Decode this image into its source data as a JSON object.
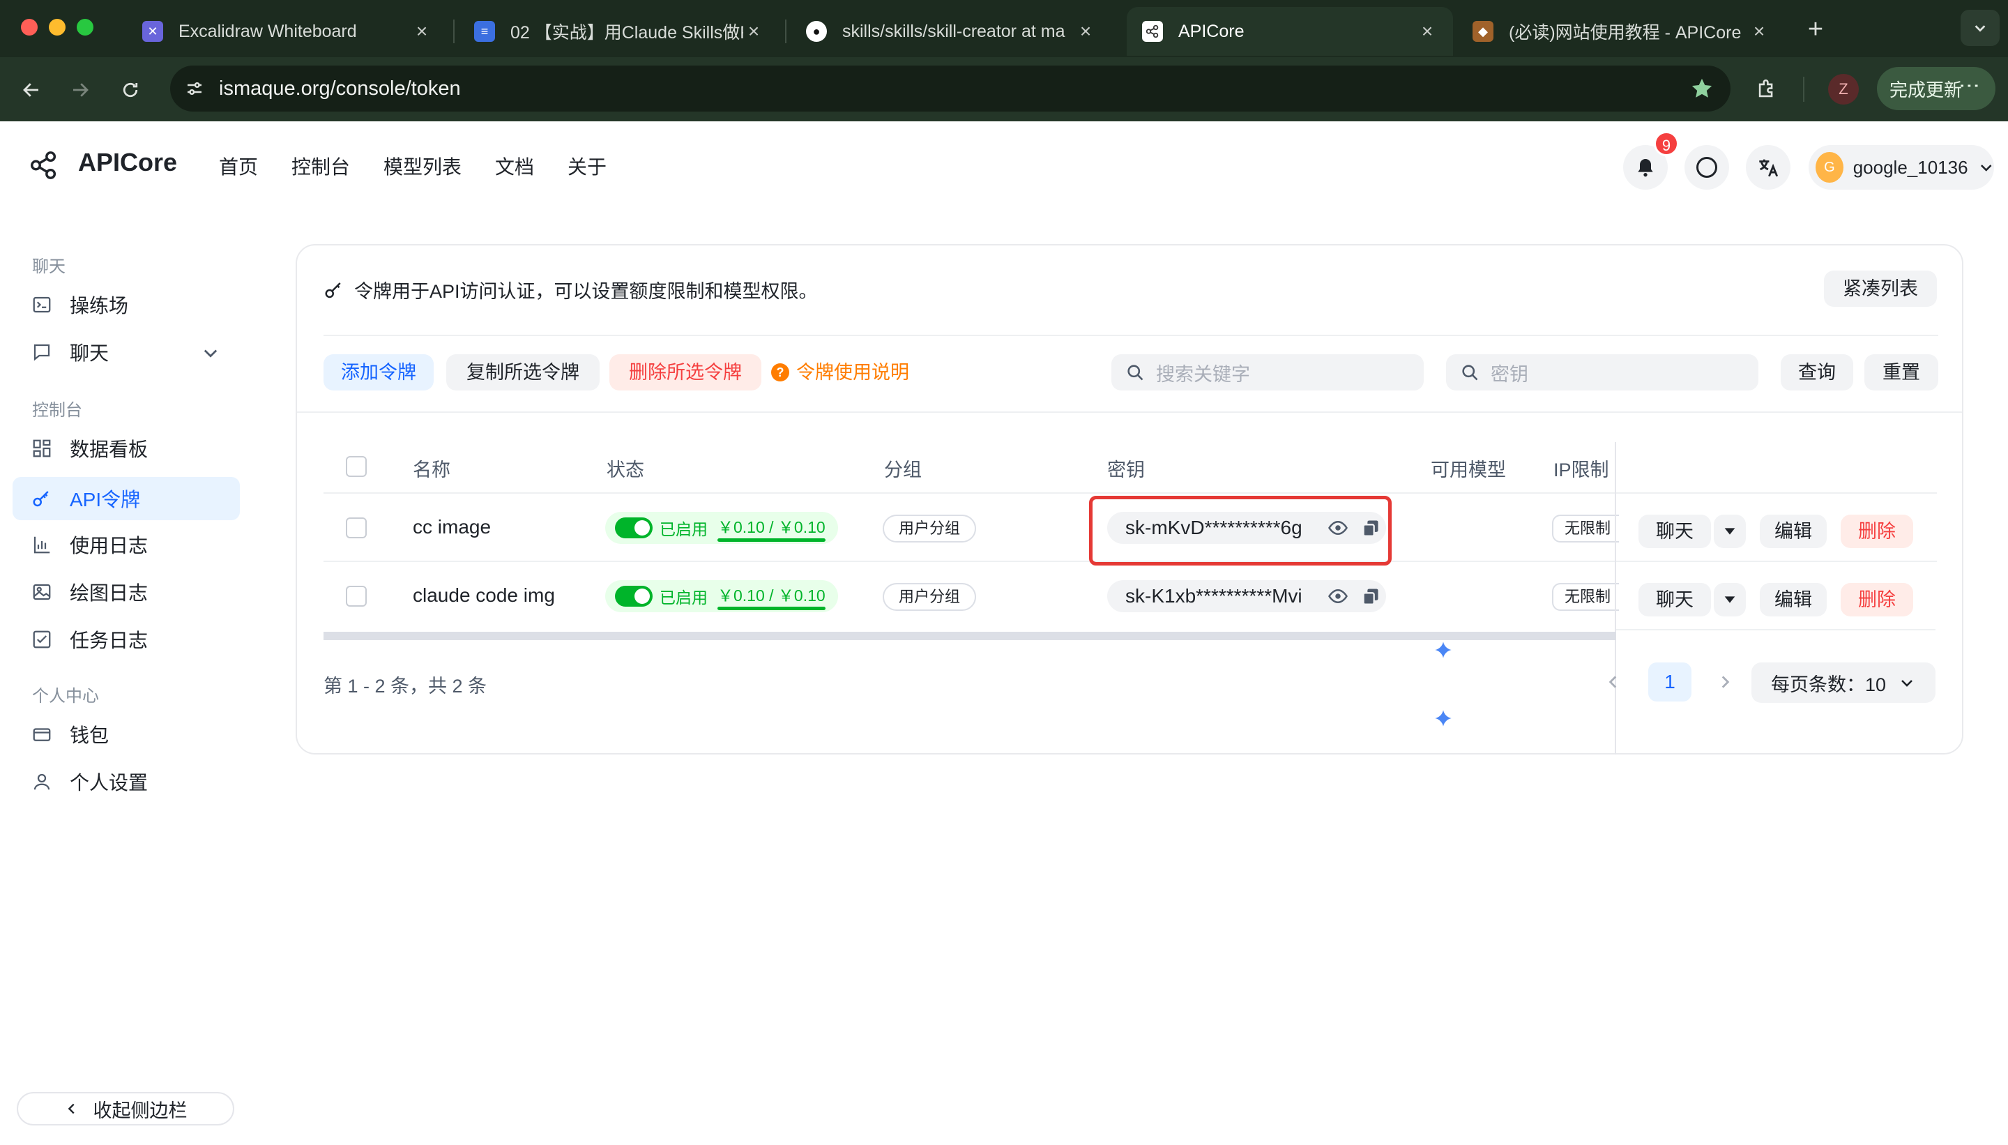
{
  "browser": {
    "tabs": [
      {
        "title": "Excalidraw Whiteboard",
        "active": false
      },
      {
        "title": "02 【实战】用Claude Skills做F",
        "active": false
      },
      {
        "title": "skills/skills/skill-creator at ma",
        "active": false
      },
      {
        "title": "APICore",
        "active": true
      },
      {
        "title": "(必读)网站使用教程 - APICore",
        "active": false
      }
    ],
    "url": "ismaque.org/console/token",
    "profile_initial": "Z",
    "update_label": "完成更新"
  },
  "header": {
    "brand": "APICore",
    "nav": [
      "首页",
      "控制台",
      "模型列表",
      "文档",
      "关于"
    ],
    "notification_count": "9",
    "user_initial": "G",
    "user_name": "google_10136"
  },
  "sidebar": {
    "groups": [
      {
        "label": "聊天",
        "items": [
          {
            "label": "操练场",
            "icon": "terminal-icon"
          },
          {
            "label": "聊天",
            "icon": "chat-icon",
            "expandable": true
          }
        ]
      },
      {
        "label": "控制台",
        "items": [
          {
            "label": "数据看板",
            "icon": "dashboard-icon"
          },
          {
            "label": "API令牌",
            "icon": "key-icon",
            "active": true
          },
          {
            "label": "使用日志",
            "icon": "bar-chart-icon"
          },
          {
            "label": "绘图日志",
            "icon": "image-icon"
          },
          {
            "label": "任务日志",
            "icon": "checkbox-icon"
          }
        ]
      },
      {
        "label": "个人中心",
        "items": [
          {
            "label": "钱包",
            "icon": "wallet-icon"
          },
          {
            "label": "个人设置",
            "icon": "user-icon"
          }
        ]
      }
    ],
    "collapse_label": "收起侧边栏"
  },
  "tokens": {
    "intro": "令牌用于API访问认证，可以设置额度限制和模型权限。",
    "compact_label": "紧凑列表",
    "actions": {
      "add": "添加令牌",
      "copy": "复制所选令牌",
      "delete": "删除所选令牌",
      "help": "令牌使用说明"
    },
    "search_placeholder": "搜索关键字",
    "key_placeholder": "密钥",
    "query_label": "查询",
    "reset_label": "重置",
    "columns": [
      "名称",
      "状态",
      "分组",
      "密钥",
      "可用模型",
      "IP限制"
    ],
    "rows": [
      {
        "name": "cc image",
        "status": "已启用",
        "quota": "￥0.10 / ￥0.10",
        "quota_fraction": 1.0,
        "group": "用户分组",
        "key": "sk-mKvD**********6g",
        "ip": "无限制",
        "chat": "聊天",
        "edit": "编辑",
        "delete": "删除"
      },
      {
        "name": "claude code img",
        "status": "已启用",
        "quota": "￥0.10 / ￥0.10",
        "quota_fraction": 1.0,
        "group": "用户分组",
        "key": "sk-K1xb**********Mvi",
        "ip": "无限制",
        "chat": "聊天",
        "edit": "编辑",
        "delete": "删除"
      }
    ],
    "pagination": {
      "summary": "第 1 - 2 条，共 2 条",
      "current": "1",
      "page_size": "每页条数：10"
    }
  },
  "colors": {
    "primary": "#1664ff",
    "danger": "#f53f3f",
    "success": "#00b42a",
    "warning": "#ff7d00"
  }
}
